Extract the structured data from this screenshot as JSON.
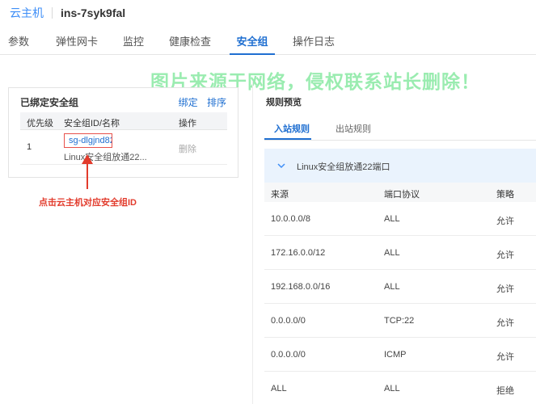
{
  "breadcrumb": {
    "parent": "云主机",
    "instance": "ins-7syk9fal"
  },
  "tabs": [
    {
      "label": "参数"
    },
    {
      "label": "弹性网卡"
    },
    {
      "label": "监控"
    },
    {
      "label": "健康检查"
    },
    {
      "label": "安全组"
    },
    {
      "label": "操作日志"
    }
  ],
  "active_tab": "安全组",
  "watermark": "图片来源于网络，侵权联系站长删除！",
  "bound_groups": {
    "title": "已绑定安全组",
    "bind_label": "绑定",
    "sort_label": "排序",
    "columns": {
      "priority": "优先级",
      "id_name": "安全组ID/名称",
      "action": "操作"
    },
    "rows": [
      {
        "priority": "1",
        "id": "sg-dlgjnd82",
        "name": "Linux安全组放通22...",
        "action": "删除"
      }
    ]
  },
  "callout": "点击云主机对应安全组ID",
  "colors": {
    "accent": "#1f6fd1",
    "highlight": "#e8514b",
    "callout": "#e23b2c",
    "group_bg": "#eaf3fd"
  },
  "preview": {
    "title": "规则预览",
    "tabs": [
      {
        "label": "入站规则"
      },
      {
        "label": "出站规则"
      }
    ],
    "group_label": "Linux安全组放通22端口",
    "columns": {
      "source": "来源",
      "port_protocol": "端口协议",
      "policy": "策略"
    },
    "rules": [
      {
        "source": "10.0.0.0/8",
        "port": "ALL",
        "policy": "允许"
      },
      {
        "source": "172.16.0.0/12",
        "port": "ALL",
        "policy": "允许"
      },
      {
        "source": "192.168.0.0/16",
        "port": "ALL",
        "policy": "允许"
      },
      {
        "source": "0.0.0.0/0",
        "port": "TCP:22",
        "policy": "允许"
      },
      {
        "source": "0.0.0.0/0",
        "port": "ICMP",
        "policy": "允许"
      },
      {
        "source": "ALL",
        "port": "ALL",
        "policy": "拒绝"
      }
    ]
  }
}
